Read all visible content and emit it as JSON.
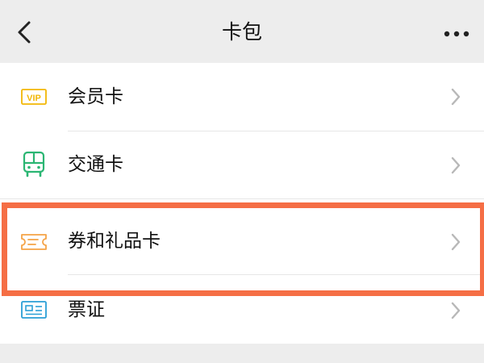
{
  "navbar": {
    "title": "卡包"
  },
  "items": [
    {
      "label": "会员卡",
      "icon": "vip-card-icon",
      "color": "#f2b705"
    },
    {
      "label": "交通卡",
      "icon": "bus-icon",
      "color": "#2bb673"
    },
    {
      "label": "券和礼品卡",
      "icon": "ticket-icon",
      "color": "#f5a346"
    },
    {
      "label": "票证",
      "icon": "id-card-icon",
      "color": "#2a9fd6"
    }
  ],
  "icons": {
    "vip_text": "VIP"
  },
  "colors": {
    "highlight": "#f56e45",
    "background": "#ededed",
    "list_background": "#ffffff"
  }
}
